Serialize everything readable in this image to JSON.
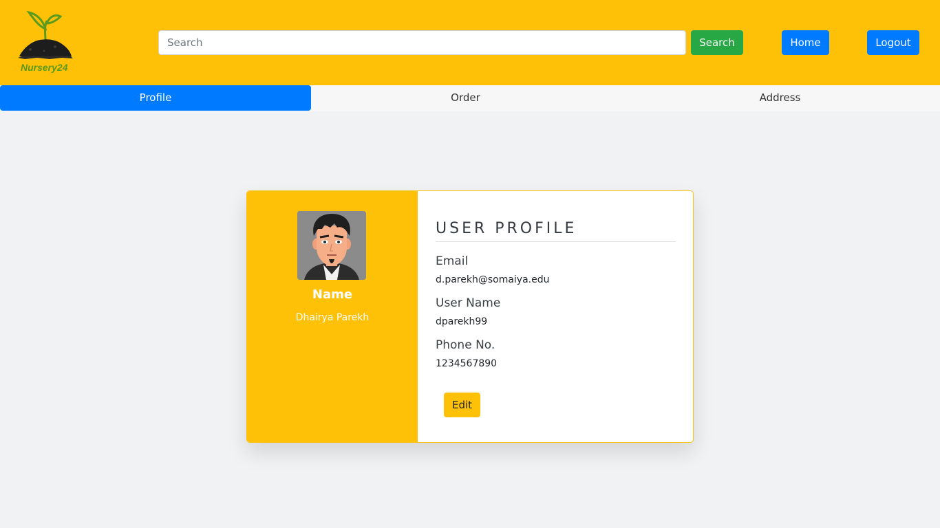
{
  "header": {
    "brand": "Nursery24",
    "search": {
      "placeholder": "Search",
      "value": ""
    },
    "search_button": "Search",
    "home_button": "Home",
    "logout_button": "Logout"
  },
  "tabs": [
    {
      "label": "Profile",
      "active": true
    },
    {
      "label": "Order",
      "active": false
    },
    {
      "label": "Address",
      "active": false
    }
  ],
  "profile": {
    "name_label": "Name",
    "name_value": "Dhairya Parekh",
    "title": "USER PROFILE",
    "fields": [
      {
        "label": "Email",
        "value": "d.parekh@somaiya.edu"
      },
      {
        "label": "User Name",
        "value": "dparekh99"
      },
      {
        "label": "Phone No.",
        "value": "1234567890"
      }
    ],
    "edit_button": "Edit"
  },
  "colors": {
    "header_bg": "#ffc107",
    "primary": "#007bff",
    "success": "#28a745",
    "page_bg": "#f1f2f3"
  },
  "icons": {
    "logo": "sprout-in-soil-logo",
    "avatar": "cartoon-man-avatar"
  }
}
